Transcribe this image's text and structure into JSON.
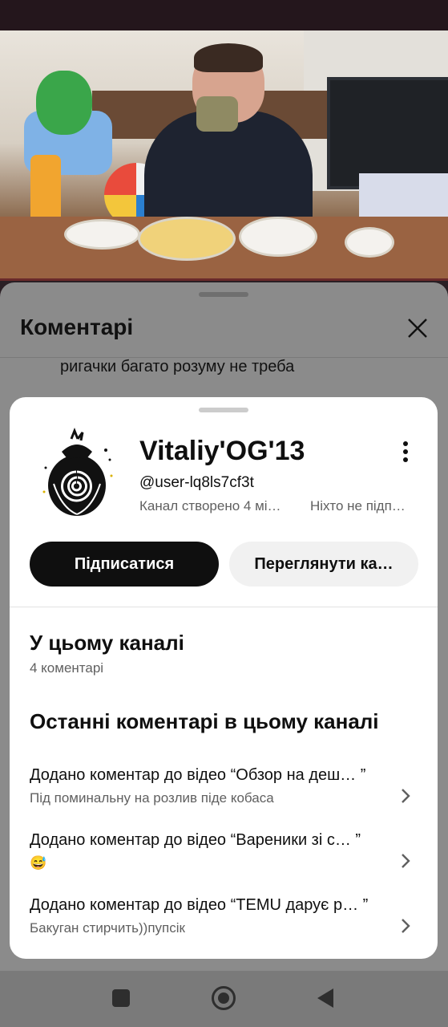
{
  "comments_panel": {
    "title": "Коментарі",
    "snippet": "ригачки багато розуму не треба"
  },
  "channel": {
    "name": "Vitaliy'OG'13",
    "handle": "@user-lq8ls7cf3t",
    "created": "Канал створено 4 мі…",
    "subscribers": "Ніхто не підп…",
    "subscribe_label": "Підписатися",
    "view_channel_label": "Переглянути ка…"
  },
  "in_channel": {
    "title": "У цьому каналі",
    "count": "4 коментарі"
  },
  "recent": {
    "title": "Останні коментарі в цьому каналі",
    "items": [
      {
        "title": "Додано коментар до відео “Обзор на деш… ”",
        "text": "Під поминальну на розлив піде кобаса"
      },
      {
        "title": "Додано коментар до відео “Вареники зі с… ”",
        "text": "😅"
      },
      {
        "title": "Додано коментар до відео “TEMU дарує р… ”",
        "text": "Бакуган стирчить))пупсік"
      }
    ]
  },
  "icons": {
    "close": "close-icon",
    "more": "more-vertical-icon",
    "chevron": "chevron-right-icon",
    "nav_recent": "square-icon",
    "nav_home": "circle-icon",
    "nav_back": "triangle-back-icon"
  }
}
